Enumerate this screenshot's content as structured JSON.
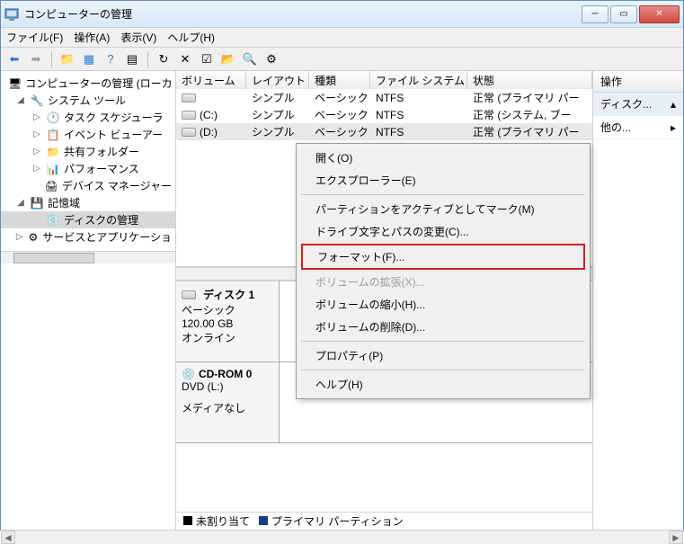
{
  "window": {
    "title": "コンピューターの管理"
  },
  "menubar": {
    "file": "ファイル(F)",
    "action": "操作(A)",
    "view": "表示(V)",
    "help": "ヘルプ(H)"
  },
  "tree": {
    "root": "コンピューターの管理 (ローカ",
    "systools": "システム ツール",
    "taskscheduler": "タスク スケジューラ",
    "eventviewer": "イベント ビューアー",
    "sharedfolders": "共有フォルダー",
    "performance": "パフォーマンス",
    "devmgr": "デバイス マネージャー",
    "storage": "記憶域",
    "diskmgmt": "ディスクの管理",
    "services": "サービスとアプリケーショ"
  },
  "grid": {
    "headers": {
      "volume": "ボリューム",
      "layout": "レイアウト",
      "type": "種類",
      "filesystem": "ファイル システム",
      "status": "状態"
    },
    "rows": [
      {
        "vol": "",
        "layout": "シンプル",
        "type": "ベーシック",
        "fs": "NTFS",
        "status": "正常 (プライマリ パー"
      },
      {
        "vol": "(C:)",
        "layout": "シンプル",
        "type": "ベーシック",
        "fs": "NTFS",
        "status": "正常 (システム, ブー"
      },
      {
        "vol": "(D:)",
        "layout": "シンプル",
        "type": "ベーシック",
        "fs": "NTFS",
        "status": "正常 (プライマリ パー"
      }
    ]
  },
  "lower": {
    "disk1": {
      "title": "ディスク 1",
      "type": "ベーシック",
      "size": "120.00 GB",
      "status": "オンライン"
    },
    "cdrom": {
      "title": "CD-ROM 0",
      "drive": "DVD (L:)",
      "media": "メディアなし"
    }
  },
  "legend": {
    "unallocated": "未割り当て",
    "primary": "プライマリ パーティション"
  },
  "actions": {
    "header": "操作",
    "item1": "ディスク...",
    "item2": "他の..."
  },
  "context": {
    "open": "開く(O)",
    "explorer": "エクスプローラー(E)",
    "markactive": "パーティションをアクティブとしてマーク(M)",
    "changedrive": "ドライブ文字とパスの変更(C)...",
    "format": "フォーマット(F)...",
    "extend": "ボリュームの拡張(X)...",
    "shrink": "ボリュームの縮小(H)...",
    "delete": "ボリュームの削除(D)...",
    "properties": "プロパティ(P)",
    "help": "ヘルプ(H)"
  }
}
